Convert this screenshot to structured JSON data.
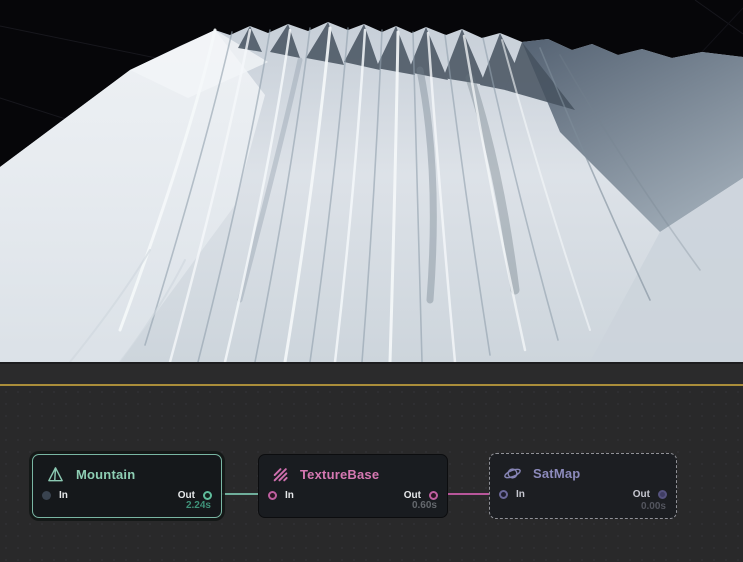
{
  "viewport": {
    "content": "3D preview of a snow-covered eroded mountain on a flat terrain tile"
  },
  "splitter": {
    "accent_color": "#aa8d3a"
  },
  "graph": {
    "nodes": [
      {
        "title": "Mountain",
        "icon": "mountain-icon",
        "in_label": "In",
        "out_label": "Out",
        "time": "2.24s",
        "accent": "#8ecfb4",
        "state": "selected"
      },
      {
        "title": "TextureBase",
        "icon": "texture-icon",
        "in_label": "In",
        "out_label": "Out",
        "time": "0.60s",
        "accent": "#d678b2",
        "state": "built"
      },
      {
        "title": "SatMap",
        "icon": "satmap-icon",
        "in_label": "In",
        "out_label": "Out",
        "time": "0.00s",
        "accent": "#8c8abc",
        "state": "pending-dashed"
      }
    ],
    "connections": [
      {
        "from": "Mountain",
        "to": "TextureBase",
        "color": "#6fae9b"
      },
      {
        "from": "TextureBase",
        "to": "SatMap",
        "color": "#b8569a"
      }
    ]
  }
}
